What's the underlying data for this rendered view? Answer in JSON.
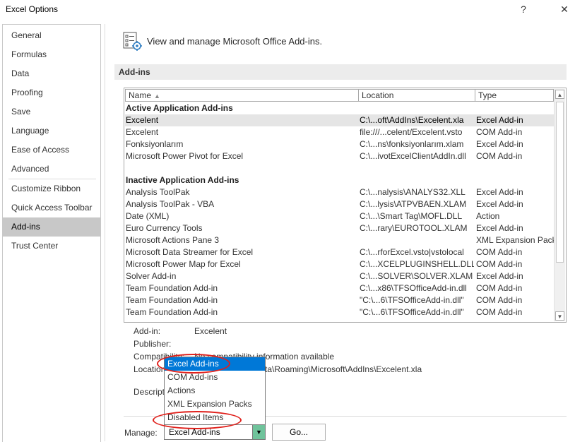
{
  "window": {
    "title": "Excel Options",
    "help_glyph": "?",
    "close_glyph": "✕"
  },
  "nav": {
    "items": [
      {
        "label": "General"
      },
      {
        "label": "Formulas"
      },
      {
        "label": "Data"
      },
      {
        "label": "Proofing"
      },
      {
        "label": "Save"
      },
      {
        "label": "Language"
      },
      {
        "label": "Ease of Access"
      },
      {
        "label": "Advanced"
      },
      {
        "label": "Customize Ribbon"
      },
      {
        "label": "Quick Access Toolbar"
      },
      {
        "label": "Add-ins"
      },
      {
        "label": "Trust Center"
      }
    ],
    "active": "Add-ins"
  },
  "header": {
    "title": "View and manage Microsoft Office Add-ins.",
    "icon": "addins-gear-icon"
  },
  "section": {
    "title": "Add-ins"
  },
  "table": {
    "columns": {
      "name": "Name",
      "location": "Location",
      "type": "Type"
    },
    "active_group": "Active Application Add-ins",
    "active_rows": [
      {
        "name": "Excelent",
        "location": "C:\\...oft\\AddIns\\Excelent.xla",
        "type": "Excel Add-in"
      },
      {
        "name": "Excelent",
        "location": "file:///...celent/Excelent.vsto",
        "type": "COM Add-in"
      },
      {
        "name": "Fonksiyonlarım",
        "location": "C:\\...ns\\fonksiyonlarım.xlam",
        "type": "Excel Add-in"
      },
      {
        "name": "Microsoft Power Pivot for Excel",
        "location": "C:\\...ivotExcelClientAddIn.dll",
        "type": "COM Add-in"
      }
    ],
    "inactive_group": "Inactive Application Add-ins",
    "inactive_rows": [
      {
        "name": "Analysis ToolPak",
        "location": "C:\\...nalysis\\ANALYS32.XLL",
        "type": "Excel Add-in"
      },
      {
        "name": "Analysis ToolPak - VBA",
        "location": "C:\\...lysis\\ATPVBAEN.XLAM",
        "type": "Excel Add-in"
      },
      {
        "name": "Date (XML)",
        "location": "C:\\...\\Smart Tag\\MOFL.DLL",
        "type": "Action"
      },
      {
        "name": "Euro Currency Tools",
        "location": "C:\\...rary\\EUROTOOL.XLAM",
        "type": "Excel Add-in"
      },
      {
        "name": "Microsoft Actions Pane 3",
        "location": "",
        "type": "XML Expansion Pack"
      },
      {
        "name": "Microsoft Data Streamer for Excel",
        "location": "C:\\...rforExcel.vsto|vstolocal",
        "type": "COM Add-in"
      },
      {
        "name": "Microsoft Power Map for Excel",
        "location": "C:\\...XCELPLUGINSHELL.DLL",
        "type": "COM Add-in"
      },
      {
        "name": "Solver Add-in",
        "location": "C:\\...SOLVER\\SOLVER.XLAM",
        "type": "Excel Add-in"
      },
      {
        "name": "Team Foundation Add-in",
        "location": "C:\\...x86\\TFSOfficeAdd-in.dll",
        "type": "COM Add-in"
      },
      {
        "name": "Team Foundation Add-in",
        "location": "\"C:\\...6\\TFSOfficeAdd-in.dll\"",
        "type": "COM Add-in"
      },
      {
        "name": "Team Foundation Add-in",
        "location": "\"C:\\...6\\TFSOfficeAdd-in.dll\"",
        "type": "COM Add-in"
      }
    ]
  },
  "details": {
    "addin_label": "Add-in:",
    "addin_value": "Excelent",
    "publisher_label": "Publisher:",
    "compat_label": "Compatibility:",
    "compat_value": "No compatibility information available",
    "location_label": "Location:",
    "location_value": "C:\\Users\\...\\AppData\\Roaming\\Microsoft\\AddIns\\Excelent.xla",
    "description_label": "Description:"
  },
  "manage": {
    "label": "Manage:",
    "selected": "Excel Add-ins",
    "go_label": "Go...",
    "options": [
      "Excel Add-ins",
      "COM Add-ins",
      "Actions",
      "XML Expansion Packs",
      "Disabled Items"
    ]
  },
  "colors": {
    "selection_blue": "#0078d7",
    "annotation_red": "#e0201b",
    "nav_active": "#c8c8c8",
    "dropdown_button": "#6fc39b"
  }
}
